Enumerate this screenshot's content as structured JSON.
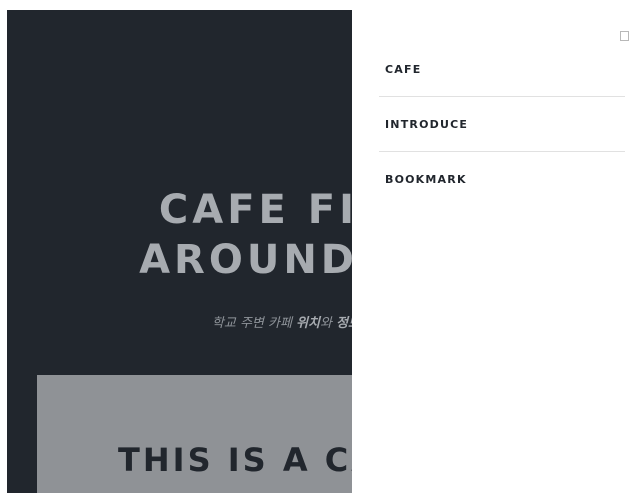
{
  "hero": {
    "title_line1": "CAFE FI",
    "title_line2": "AROUND",
    "subtitle_pre": "학교 주변 카페 ",
    "subtitle_b1": "위치",
    "subtitle_mid": "와 ",
    "subtitle_b2": "정보"
  },
  "intro": {
    "title": "THIS IS A CA"
  },
  "nav": {
    "items": [
      {
        "label": "CAFE"
      },
      {
        "label": "INTRODUCE"
      },
      {
        "label": "BOOKMARK"
      }
    ]
  },
  "colors": {
    "hero_bg": "#21262d",
    "hero_text": "#a7abb0",
    "intro_bg": "#8f9296",
    "nav_bg": "#ffffff"
  },
  "icons": {
    "close": "close-icon"
  }
}
